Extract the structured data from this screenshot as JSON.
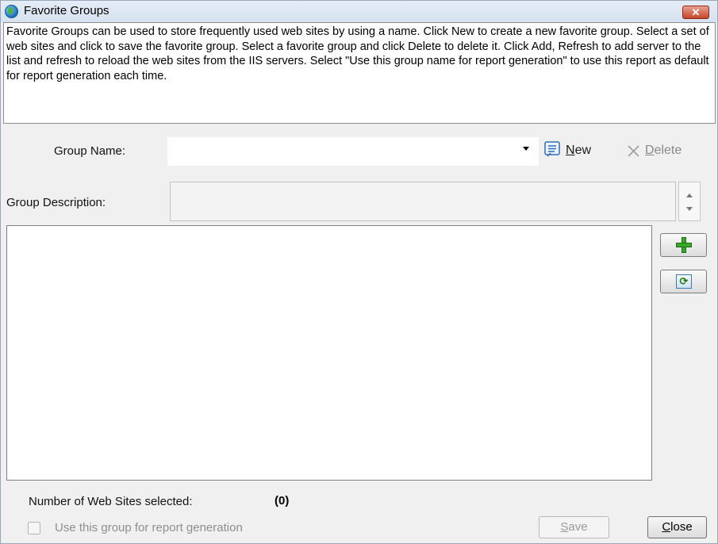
{
  "window": {
    "title": "Favorite Groups",
    "close_glyph": "✕"
  },
  "description": "Favorite Groups can be used to store frequently used web sites by using a name. Click New to create a new favorite group. Select a set of web sites and click to save the favorite group. Select a favorite group and click Delete to delete it. Click Add, Refresh to add server to the list and refresh to reload the web sites from the IIS servers. Select \"Use this group name for report generation\" to use this report as default for report generation each time.",
  "group_name": {
    "label": "Group Name:",
    "value": "",
    "new_mnemonic": "N",
    "new_rest": "ew",
    "delete_mnemonic": "D",
    "delete_rest": "elete"
  },
  "group_description": {
    "label": "Group Description:",
    "value": ""
  },
  "websites_list": [],
  "side_buttons": {
    "add_icon": "plus-icon",
    "refresh_icon": "refresh-icon",
    "refresh_glyph": "⟳"
  },
  "footer": {
    "count_label": "Number of Web Sites selected:",
    "count_value": "(0)",
    "checkbox_label": "Use this group for report generation",
    "checkbox_checked": false,
    "save_mnemonic": "S",
    "save_rest": "ave",
    "close_mnemonic": "C",
    "close_rest": "lose"
  },
  "colors": {
    "titlebar": "#dbe6f3",
    "close_button": "#c7452c",
    "add_green": "#39a82b",
    "disabled_text": "#8e8e8e"
  }
}
